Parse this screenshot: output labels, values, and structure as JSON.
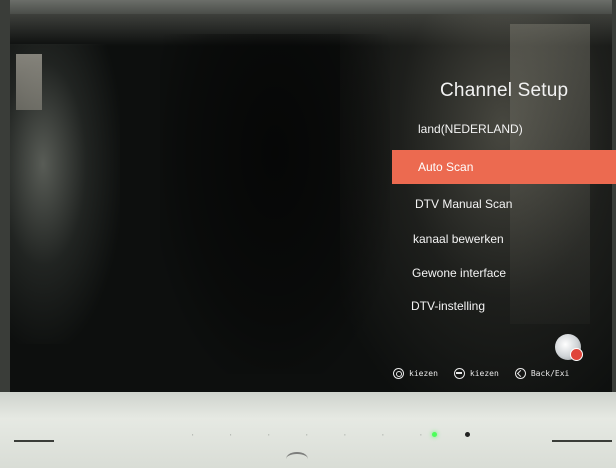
{
  "menu": {
    "title": "Channel Setup",
    "items": [
      {
        "label": "land(NEDERLAND)",
        "selected": false
      },
      {
        "label": "Auto Scan",
        "selected": true
      },
      {
        "label": "DTV Manual Scan",
        "selected": false
      },
      {
        "label": "kanaal bewerken",
        "selected": false
      },
      {
        "label": "Gewone interface",
        "selected": false
      },
      {
        "label": "DTV-instelling",
        "selected": false
      }
    ],
    "accent_color": "#ec6a50"
  },
  "helpbar": {
    "hint1": "kiezen",
    "hint2": "kiezen",
    "hint3": "Back/Exi"
  },
  "icons": {
    "hint1_icon": "ok-icon",
    "hint2_icon": "menu-icon",
    "hint3_icon": "back-icon",
    "corner_icon": "app-badge-icon"
  },
  "bezel": {
    "led_color": "#4cff5a"
  }
}
